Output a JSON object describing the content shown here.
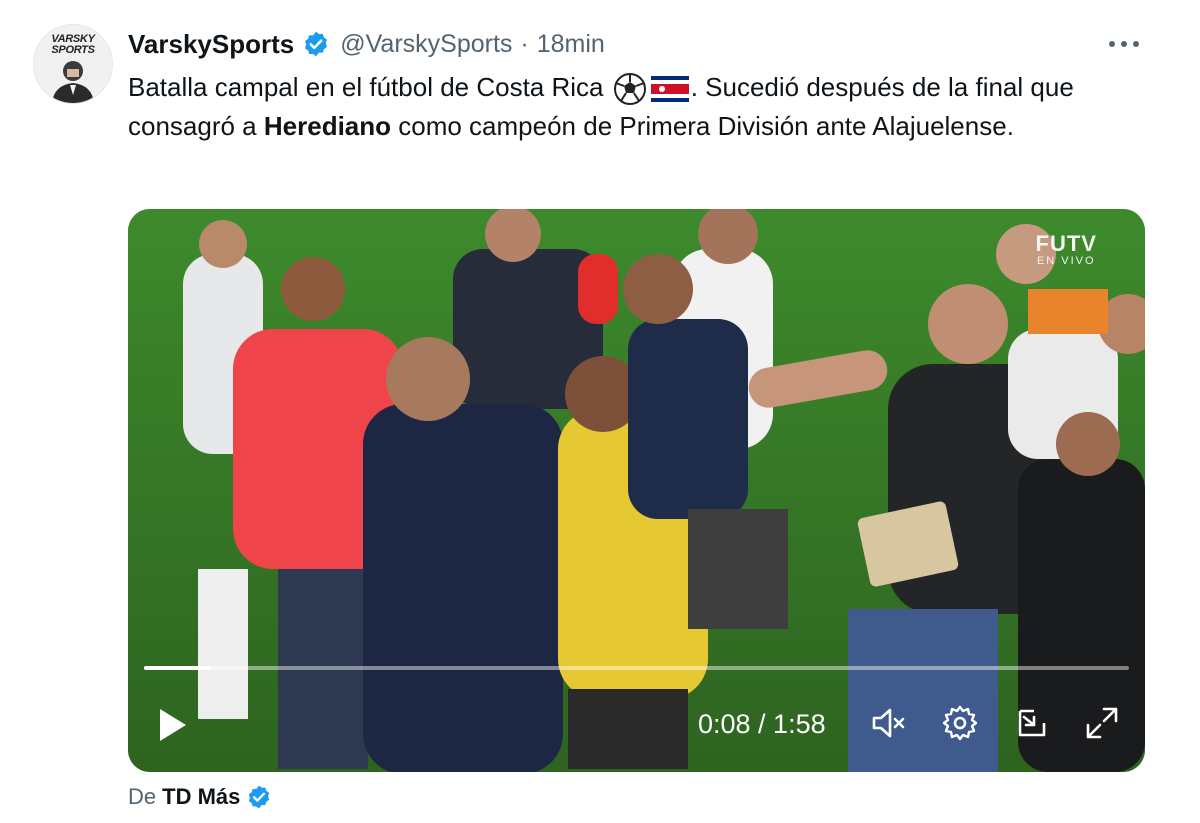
{
  "author": {
    "avatar_text_line1": "VARSKY",
    "avatar_text_line2": "SPORTS",
    "name": "VarskySports",
    "handle": "@VarskySports",
    "separator": "·",
    "time": "18min"
  },
  "tweet": {
    "text_part1": "Batalla campal en el fútbol de Costa Rica ",
    "text_part2": ". Sucedió después de la final que consagró a ",
    "bold_word": "Herediano",
    "text_part3": " como campeón de Primera División ante Alajuelense.",
    "emojis": [
      "soccer-ball-icon",
      "costa-rica-flag-icon"
    ]
  },
  "video": {
    "watermark_title": "FUTV",
    "watermark_sub": "EN VIVO",
    "progress_fraction": 0.068,
    "time_display": "0:08 / 1:58",
    "controls": [
      "play-icon",
      "mute-icon",
      "settings-icon",
      "pip-icon",
      "fullscreen-icon"
    ]
  },
  "source": {
    "prefix": "De",
    "account": "TD Más"
  },
  "colors": {
    "verified": "#1d9bf0",
    "muted_text": "#536471",
    "pitch": "#3f7a2a"
  }
}
